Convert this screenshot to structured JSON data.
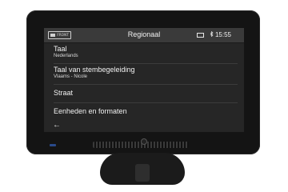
{
  "status_bar": {
    "logo_text": "FRONT",
    "title": "Regionaal",
    "bluetooth_icon": "bluetooth-icon",
    "time": "15:55"
  },
  "menu": {
    "items": [
      {
        "label": "Taal",
        "value": "Nederlands"
      },
      {
        "label": "Taal van stembegeleiding",
        "value": "Vlaams - Nicole"
      },
      {
        "label": "Straat",
        "value": ""
      },
      {
        "label": "Eenheden en formaten",
        "value": ""
      }
    ]
  },
  "nav": {
    "back_icon": "←"
  },
  "colors": {
    "screen_bg": "#262626",
    "status_bg": "#3a3a3a",
    "device": "#141414"
  }
}
